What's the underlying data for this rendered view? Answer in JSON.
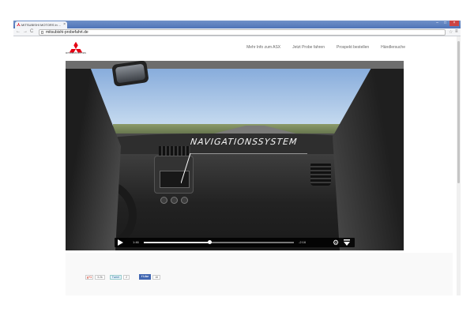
{
  "browser": {
    "tab_title": "MITSUBISHI MOTORS in ...",
    "url": "mitsubishi-probefahrt.de",
    "back_icon": "back-arrow-icon",
    "forward_icon": "forward-arrow-icon",
    "reload_icon": "reload-icon"
  },
  "header": {
    "logo_text": "MITSUBISHI MOTORS",
    "nav": [
      {
        "label": "Mehr Info zum ASX"
      },
      {
        "label": "Jetzt Probe fahren"
      },
      {
        "label": "Prospekt bestellen"
      },
      {
        "label": "Händlersuche"
      }
    ]
  },
  "video": {
    "callout": "NAVIGATIONSSYSTEM",
    "time_elapsed": "1:46",
    "time_remaining": "-2:16",
    "progress": 0.44
  },
  "social": {
    "gplus_label": "g+1",
    "gplus_count": "3.2k",
    "tweet_label": "Tweet",
    "tweet_count": "2",
    "fb_label": "Like",
    "fb_count": "16"
  },
  "colors": {
    "brand_red": "#e60012",
    "tab_bar": "#4f74b8"
  }
}
